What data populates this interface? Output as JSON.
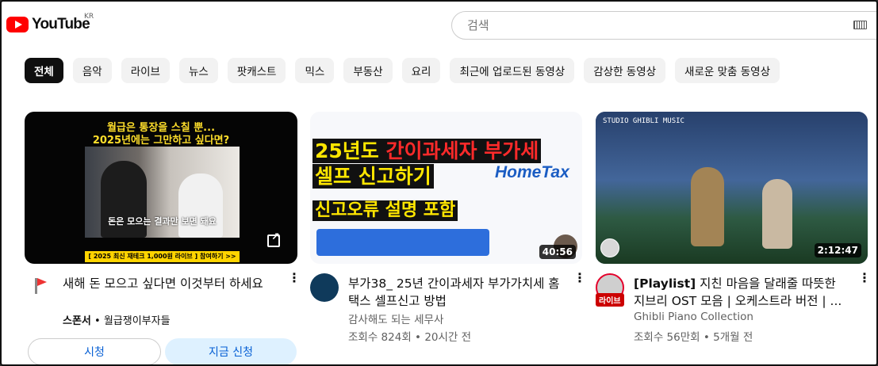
{
  "header": {
    "logo_text": "YouTube",
    "region": "KR",
    "search_placeholder": "검색"
  },
  "chips": [
    "전체",
    "음악",
    "라이브",
    "뉴스",
    "팟캐스트",
    "믹스",
    "부동산",
    "요리",
    "최근에 업로드된 동영상",
    "감상한 동영상",
    "새로운 맞춤 동영상"
  ],
  "videos": [
    {
      "title": "새해 돈 모으고 싶다면 이것부터 하세요",
      "sponsor_label": "스폰서",
      "channel": "월급쟁이부자들",
      "thumb_text_1": "월급은 통장을 스칠 뿐...",
      "thumb_text_2": "2025년에는 그만하고 싶다면?",
      "thumb_caption": "돈은 모으는 결과만 보면 돼요",
      "thumb_bottom": "[ 2025 최신 재테크 1,000원 라이브 ] 참여하기 >>",
      "watch_label": "시청",
      "apply_label": "지금 신청"
    },
    {
      "title": "부가38_ 25년 간이과세자 부가가치세 홈택스 셀프신고 방법",
      "channel": "감사해도 되는 세무사",
      "views": "조회수 824회",
      "age": "20시간 전",
      "duration": "40:56",
      "thumb_line1a": "25년도",
      "thumb_line1b": "간이과세자 부가세",
      "thumb_line2": "셀프 신고하기",
      "thumb_line3": "신고오류 설명 포함",
      "thumb_brand": "HomeTax"
    },
    {
      "title_tag": "[Playlist]",
      "title": "지친 마음을 달래줄 따뜻한 지브리 OST 모음 | 오케스트라 버전 | ...",
      "channel": "Ghibli Piano Collection",
      "views": "조회수 56만회",
      "age": "5개월 전",
      "duration": "2:12:47",
      "live_badge": "라이브",
      "thumb_header": "STUDIO GHIBLI MUSIC"
    }
  ],
  "meta_separator": "•"
}
